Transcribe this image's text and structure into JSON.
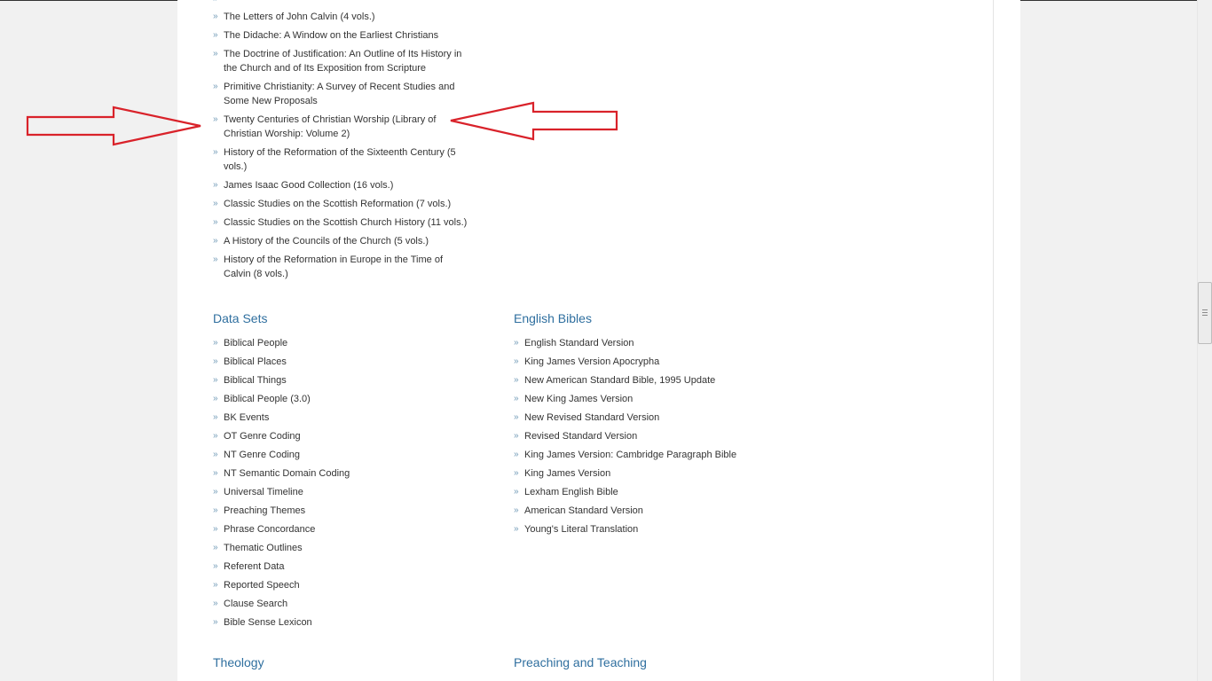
{
  "history_list": [
    "The Letters of John Calvin (4 vols.)",
    "The Didache: A Window on the Earliest Christians",
    "The Doctrine of Justification: An Outline of Its History in the Church and of Its Exposition from Scripture",
    "Primitive Christianity: A Survey of Recent Studies and Some New Proposals",
    "Twenty Centuries of Christian Worship (Library of Christian Worship: Volume 2)",
    "History of the Reformation of the Sixteenth Century (5 vols.)",
    "James Isaac Good Collection (16 vols.)",
    "Classic Studies on the Scottish Reformation (7 vols.)",
    "Classic Studies on the Scottish Church History (11 vols.)",
    "A History of the Councils of the Church (5 vols.)",
    "History of the Reformation in Europe in the Time of Calvin (8 vols.)"
  ],
  "data_sets": {
    "heading": "Data Sets",
    "items": [
      "Biblical People",
      "Biblical Places",
      "Biblical Things",
      "Biblical People (3.0)",
      "BK Events",
      "OT Genre Coding",
      "NT Genre Coding",
      "NT Semantic Domain Coding",
      "Universal Timeline",
      "Preaching Themes",
      "Phrase Concordance",
      "Thematic Outlines",
      "Referent Data",
      "Reported Speech",
      "Clause Search",
      "Bible Sense Lexicon"
    ]
  },
  "english_bibles": {
    "heading": "English Bibles",
    "items": [
      "English Standard Version",
      "King James Version Apocrypha",
      "New American Standard Bible, 1995 Update",
      "New King James Version",
      "New Revised Standard Version",
      "Revised Standard Version",
      "King James Version: Cambridge Paragraph Bible",
      "King James Version",
      "Lexham English Bible",
      "American Standard Version",
      "Young's Literal Translation"
    ]
  },
  "theology": {
    "heading": "Theology"
  },
  "preaching": {
    "heading": "Preaching and Teaching"
  },
  "bullet": "»",
  "colors": {
    "link": "#333333",
    "heading": "#2f6f9f",
    "bullet": "#6f99b6",
    "annotation_arrow": "#d9222a"
  },
  "icons": {
    "bullet": "double-chevron-right-icon",
    "annotation": "red-outline-arrow-icon"
  }
}
